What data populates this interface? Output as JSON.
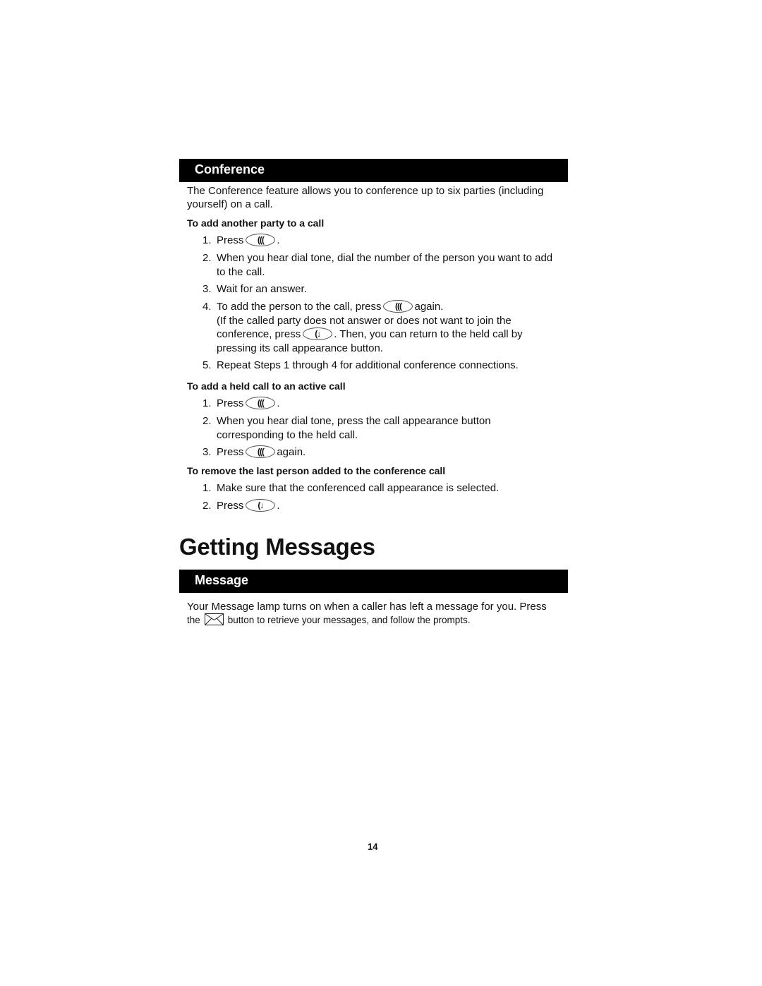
{
  "conference": {
    "title": "Conference",
    "intro": "The Conference feature allows you to conference up to six parties (including yourself) on a call.",
    "add_party": {
      "heading": "To add another party to a call",
      "s1_num": "1.",
      "s1_pre": "Press",
      "s1_post": ".",
      "s2_num": "2.",
      "s2": "When you hear dial tone, dial the number of the person you want to add to the call.",
      "s3_num": "3.",
      "s3": "Wait for an answer.",
      "s4_num": "4.",
      "s4_pre": "To add the person to the call, press",
      "s4_post": "again.",
      "s4_note_pre": "(If the called party does not answer or does not want to join the conference, press",
      "s4_note_post": ". Then, you can return to the held call by pressing its call appearance button.",
      "s5_num": "5.",
      "s5": "Repeat Steps 1 through 4 for additional conference connections."
    },
    "add_held": {
      "heading": "To add a held call to an active call",
      "s1_num": "1.",
      "s1_pre": "Press",
      "s1_post": ".",
      "s2_num": "2.",
      "s2": "When you hear dial tone, press the call appearance button corresponding to the held call.",
      "s3_num": "3.",
      "s3_pre": "Press",
      "s3_post": "again."
    },
    "remove_last": {
      "heading": "To remove the last person added to the conference call",
      "s1_num": "1.",
      "s1": "Make sure that the conferenced call appearance is selected.",
      "s2_num": "2.",
      "s2_pre": "Press",
      "s2_post": "."
    }
  },
  "icons": {
    "conference_key": "(((",
    "drop_key": "(↓"
  },
  "getting_messages": {
    "title": "Getting Messages",
    "section": "Message",
    "line1": "Your Message lamp turns on when a caller has left a message for you. Press",
    "line2_pre": "the",
    "line2_post": "button to retrieve your messages, and follow the prompts."
  },
  "page_number": "14"
}
